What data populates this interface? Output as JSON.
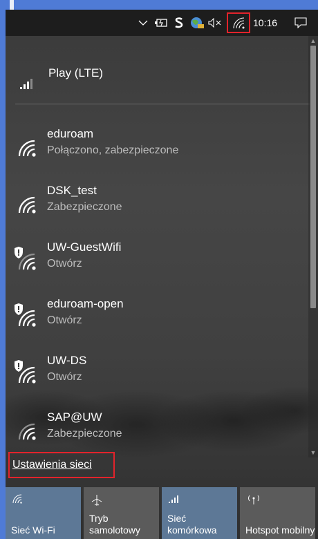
{
  "taskbar": {
    "clock": "10:16",
    "icons": [
      "chevron-up-icon",
      "battery-icon",
      "dollar-icon",
      "network-globe-icon",
      "speaker-muted-icon",
      "wifi-icon",
      "action-center-icon"
    ]
  },
  "cellular": {
    "name": "Play (LTE)",
    "icon": "cellular-signal-icon"
  },
  "networks": [
    {
      "name": "eduroam",
      "status": "Połączono, zabezpieczone",
      "open": false,
      "strong": true
    },
    {
      "name": "DSK_test",
      "status": "Zabezpieczone",
      "open": false,
      "strong": true
    },
    {
      "name": "UW-GuestWifi",
      "status": "Otwórz",
      "open": true,
      "strong": false
    },
    {
      "name": "eduroam-open",
      "status": "Otwórz",
      "open": true,
      "strong": true
    },
    {
      "name": "UW-DS",
      "status": "Otwórz",
      "open": true,
      "strong": true
    },
    {
      "name": "SAP@UW",
      "status": "Zabezpieczone",
      "open": false,
      "strong": false
    }
  ],
  "settings_link": "Ustawienia sieci",
  "tiles": [
    {
      "label": "Sieć Wi-Fi",
      "icon": "wifi-icon",
      "active": true
    },
    {
      "label": "Tryb samolotowy",
      "icon": "airplane-icon",
      "active": false
    },
    {
      "label": "Sieć komórkowa",
      "icon": "cellular-signal-icon",
      "active": true
    },
    {
      "label": "Hotspot mobilny",
      "icon": "hotspot-icon",
      "active": false
    }
  ],
  "colors": {
    "accent": "#4f7bd6",
    "highlight": "#e3232b",
    "tile_active": "#5d7896",
    "tile_inactive": "#5b5b5b"
  }
}
